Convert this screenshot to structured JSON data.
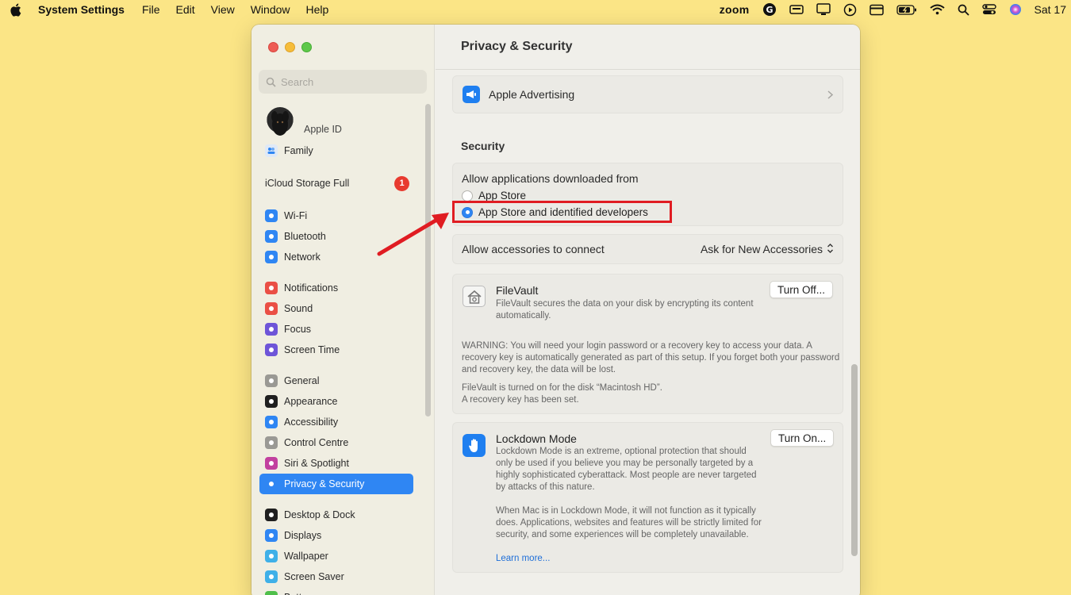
{
  "menubar": {
    "app_name": "System Settings",
    "menus": [
      "File",
      "Edit",
      "View",
      "Window",
      "Help"
    ],
    "zoom_label": "zoom",
    "clock": "Sat 17"
  },
  "sidebar": {
    "search_placeholder": "Search",
    "apple_id_label": "Apple ID",
    "family_label": "Family",
    "icloud_label": "iCloud Storage Full",
    "icloud_badge": "1",
    "items": [
      {
        "label": "Wi-Fi",
        "color": "#2f86f3"
      },
      {
        "label": "Bluetooth",
        "color": "#2f86f3"
      },
      {
        "label": "Network",
        "color": "#2f86f3"
      },
      {
        "label": "Notifications",
        "color": "#ea4f45"
      },
      {
        "label": "Sound",
        "color": "#ea4f45"
      },
      {
        "label": "Focus",
        "color": "#6e55d8"
      },
      {
        "label": "Screen Time",
        "color": "#6e55d8"
      },
      {
        "label": "General",
        "color": "#9a9994"
      },
      {
        "label": "Appearance",
        "color": "#1f1f1f"
      },
      {
        "label": "Accessibility",
        "color": "#2f86f3"
      },
      {
        "label": "Control Centre",
        "color": "#9a9994"
      },
      {
        "label": "Siri & Spotlight",
        "color": "#c2409f"
      },
      {
        "label": "Privacy & Security",
        "color": "#2f86f3",
        "active": true
      },
      {
        "label": "Desktop & Dock",
        "color": "#1f1f1f"
      },
      {
        "label": "Displays",
        "color": "#2f86f3"
      },
      {
        "label": "Wallpaper",
        "color": "#3fb0e8"
      },
      {
        "label": "Screen Saver",
        "color": "#3fb0e8"
      },
      {
        "label": "Battery",
        "color": "#4fbf4a"
      }
    ]
  },
  "main": {
    "title": "Privacy & Security",
    "apple_advertising": "Apple Advertising",
    "security_title": "Security",
    "allow_heading": "Allow applications downloaded from",
    "radio_app_store": "App Store",
    "radio_identified": "App Store and identified developers",
    "accessories_label": "Allow accessories to connect",
    "accessories_value": "Ask for New Accessories",
    "filevault": {
      "title": "FileVault",
      "desc": "FileVault secures the data on your disk by encrypting its content automatically.",
      "button": "Turn Off...",
      "warning": "WARNING: You will need your login password or a recovery key to access your data. A recovery key is automatically generated as part of this setup. If you forget both your password and recovery key, the data will be lost.",
      "status_line1": "FileVault is turned on for the disk “Macintosh HD”.",
      "status_line2": "A recovery key has been set."
    },
    "lockdown": {
      "title": "Lockdown Mode",
      "desc": "Lockdown Mode is an extreme, optional protection that should only be used if you believe you may be personally targeted by a highly sophisticated cyberattack. Most people are never targeted by attacks of this nature.",
      "desc2": "When Mac is in Lockdown Mode, it will not function as it typically does. Applications, websites and features will be strictly limited for security, and some experiences will be completely unavailable.",
      "link": "Learn more...",
      "button": "Turn On..."
    }
  },
  "annotation_color": "#e01c22"
}
